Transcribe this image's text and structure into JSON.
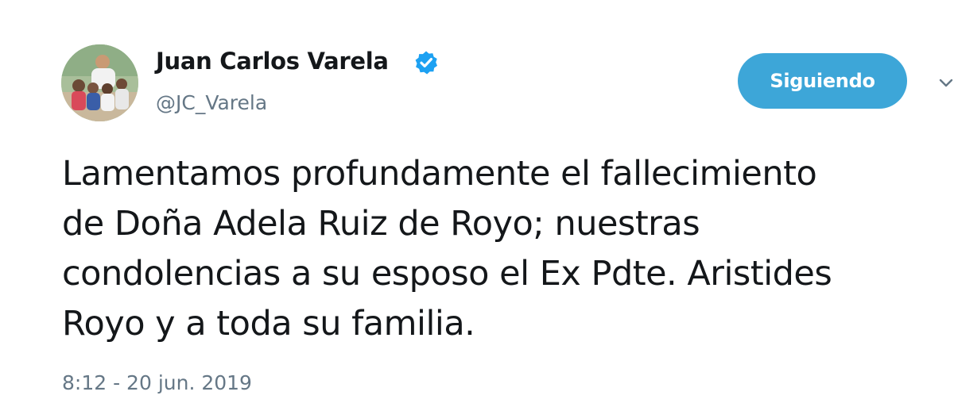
{
  "author": {
    "display_name": "Juan Carlos Varela",
    "handle": "@JC_Varela",
    "verified": true,
    "avatar_icon": "profile-photo-group"
  },
  "follow_button": {
    "label": "Siguiendo"
  },
  "tweet": {
    "lines": [
      "Lamentamos profundamente el fallecimiento",
      "de Doña Adela Ruiz de Royo; nuestras",
      "condolencias a su esposo el Ex Pdte. Aristides",
      "Royo y a toda su familia."
    ],
    "timestamp": "8:12 - 20 jun. 2019"
  },
  "colors": {
    "accent": "#3da6d8",
    "verified_badge": "#1da1f2",
    "text_primary": "#14171a",
    "text_secondary": "#657786"
  },
  "icons": {
    "verified": "verified-badge-icon",
    "more_options": "chevron-down-icon"
  }
}
